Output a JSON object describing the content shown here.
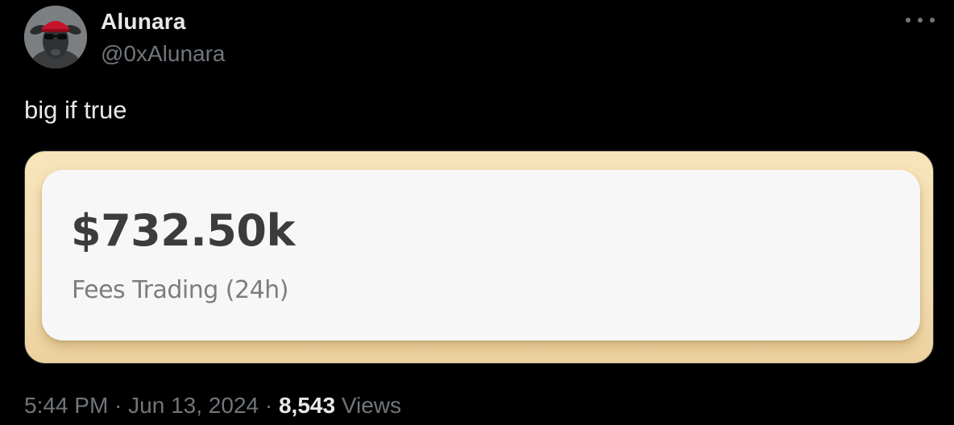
{
  "author": {
    "display_name": "Alunara",
    "handle": "@0xAlunara",
    "avatar_icon": "sheep-with-red-cap-and-sunglasses-avatar"
  },
  "tweet": {
    "text": "big if true"
  },
  "media": {
    "value": "$732.50k",
    "label": "Fees Trading (24h)",
    "outer_color": "#f5e0b5",
    "card_color": "#f7f7f8"
  },
  "meta": {
    "time": "5:44 PM",
    "separator": " · ",
    "date": "Jun 13, 2024",
    "views_count": "8,543",
    "views_label": "Views"
  },
  "icons": {
    "more": "more-horizontal-icon"
  },
  "colors": {
    "background": "#000000",
    "primary_text": "#e7e9ea",
    "secondary_text": "#71767b"
  }
}
